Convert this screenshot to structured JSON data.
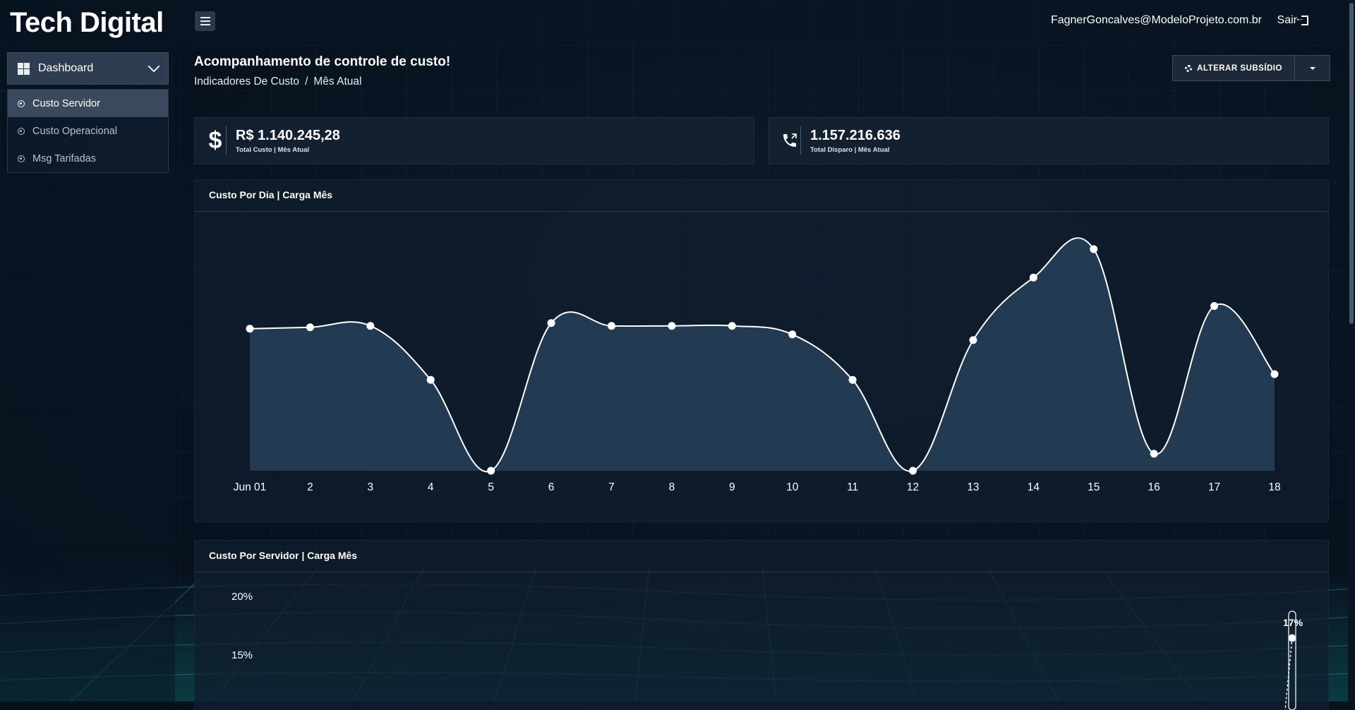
{
  "brand": "Tech Digital",
  "sidebar": {
    "menu_label": "Dashboard",
    "items": [
      {
        "label": "Custo Servidor"
      },
      {
        "label": "Custo Operacional"
      },
      {
        "label": "Msg Tarifadas"
      }
    ]
  },
  "topbar": {
    "user_email": "FagnerGoncalves@ModeloProjeto.com.br",
    "logout_label": "Sair"
  },
  "header": {
    "title": "Acompanhamento de controle de custo!",
    "breadcrumb": [
      "Indicadores De Custo",
      "/",
      "Mês Atual"
    ],
    "action_label": "ALTERAR SUBSÍDIO"
  },
  "stats": [
    {
      "icon": "dollar-icon",
      "value": "R$ 1.140.245,28",
      "label": "Total Custo | Mês Atual"
    },
    {
      "icon": "phone-icon",
      "value": "1.157.216.636",
      "label": "Total Disparo | Mês Atual"
    }
  ],
  "chart_data": [
    {
      "type": "area",
      "title": "Custo Por Dia | Carga Mês",
      "categories": [
        "Jun 01",
        "2",
        "3",
        "4",
        "5",
        "6",
        "7",
        "8",
        "9",
        "10",
        "11",
        "12",
        "13",
        "14",
        "15",
        "16",
        "17",
        "18"
      ],
      "values": [
        50,
        50.5,
        51,
        32,
        0,
        52,
        51,
        51,
        51,
        48,
        32,
        0,
        46,
        68,
        78,
        6,
        58,
        34
      ],
      "ylim": [
        0,
        80
      ],
      "colors": {
        "line": "#ffffff",
        "fill": "#2a4560"
      }
    },
    {
      "type": "line",
      "title": "Custo Por Servidor | Carga Mês",
      "yticks": [
        "20%",
        "15%"
      ],
      "data_labels": [
        "17%"
      ]
    }
  ]
}
